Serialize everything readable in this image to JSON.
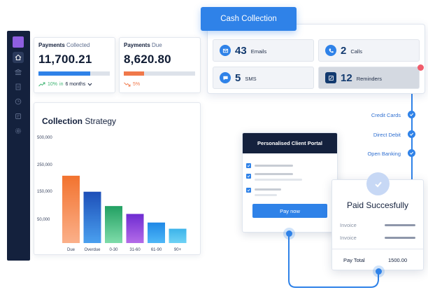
{
  "colors": {
    "accent": "#2f82e8",
    "sidebar": "#14213d",
    "green": "#3cb371",
    "orange": "#f0784a",
    "logo": "#8f5fe0"
  },
  "sidebar": {
    "items": [
      {
        "icon": "home-icon"
      },
      {
        "icon": "bank-icon"
      },
      {
        "icon": "document-icon"
      },
      {
        "icon": "clock-icon"
      },
      {
        "icon": "invoice-icon"
      },
      {
        "icon": "gear-icon"
      }
    ]
  },
  "payments_collected": {
    "title_bold": "Payments",
    "title_light": "Collected",
    "value": "11,700.21",
    "progress": 0.73,
    "trend": "10%",
    "period_in": "in",
    "period": "6 months"
  },
  "payments_due": {
    "title_bold": "Payments",
    "title_light": "Due",
    "value": "8,620.80",
    "progress": 0.28,
    "trend": "5%"
  },
  "chart": {
    "title_bold": "Collection",
    "title_light": "Strategy"
  },
  "chart_data": {
    "type": "bar",
    "title": "Collection Strategy",
    "categories": [
      "Due",
      "Overdue",
      "0-30",
      "31-60",
      "61-90",
      "90+"
    ],
    "values": [
      282000,
      215000,
      155000,
      122000,
      86000,
      60000
    ],
    "y_ticks": [
      "500,000",
      "250,000",
      "150,000",
      "50,000"
    ],
    "colors": [
      [
        "#fbb08a",
        "#f2732f"
      ],
      [
        "#4aa0ef",
        "#1d4fb8"
      ],
      [
        "#7fdcaa",
        "#22a062"
      ],
      [
        "#b46ce8",
        "#6e2bd1"
      ],
      [
        "#4fb8f7",
        "#1f88e6"
      ],
      [
        "#6fd2f5",
        "#3cb3ea"
      ]
    ]
  },
  "cash": {
    "tab": "Cash Collection",
    "tiles": [
      {
        "count": "43",
        "label": "Emails",
        "icon": "email-icon"
      },
      {
        "count": "2",
        "label": "Calls",
        "icon": "phone-icon"
      },
      {
        "count": "5",
        "label": "SMS",
        "icon": "sms-icon"
      },
      {
        "count": "12",
        "label": "Reminders",
        "icon": "reminder-icon"
      }
    ]
  },
  "methods": [
    {
      "label": "Credit Cards"
    },
    {
      "label": "Direct Debit"
    },
    {
      "label": "Open Banking"
    }
  ],
  "portal": {
    "title": "Personalised Client Portal",
    "button": "Pay now"
  },
  "paid": {
    "title": "Paid Succesfully",
    "invoice1": "Invoice",
    "invoice2": "Invoice",
    "total_label": "Pay Total",
    "total_amount": "1500.00"
  }
}
